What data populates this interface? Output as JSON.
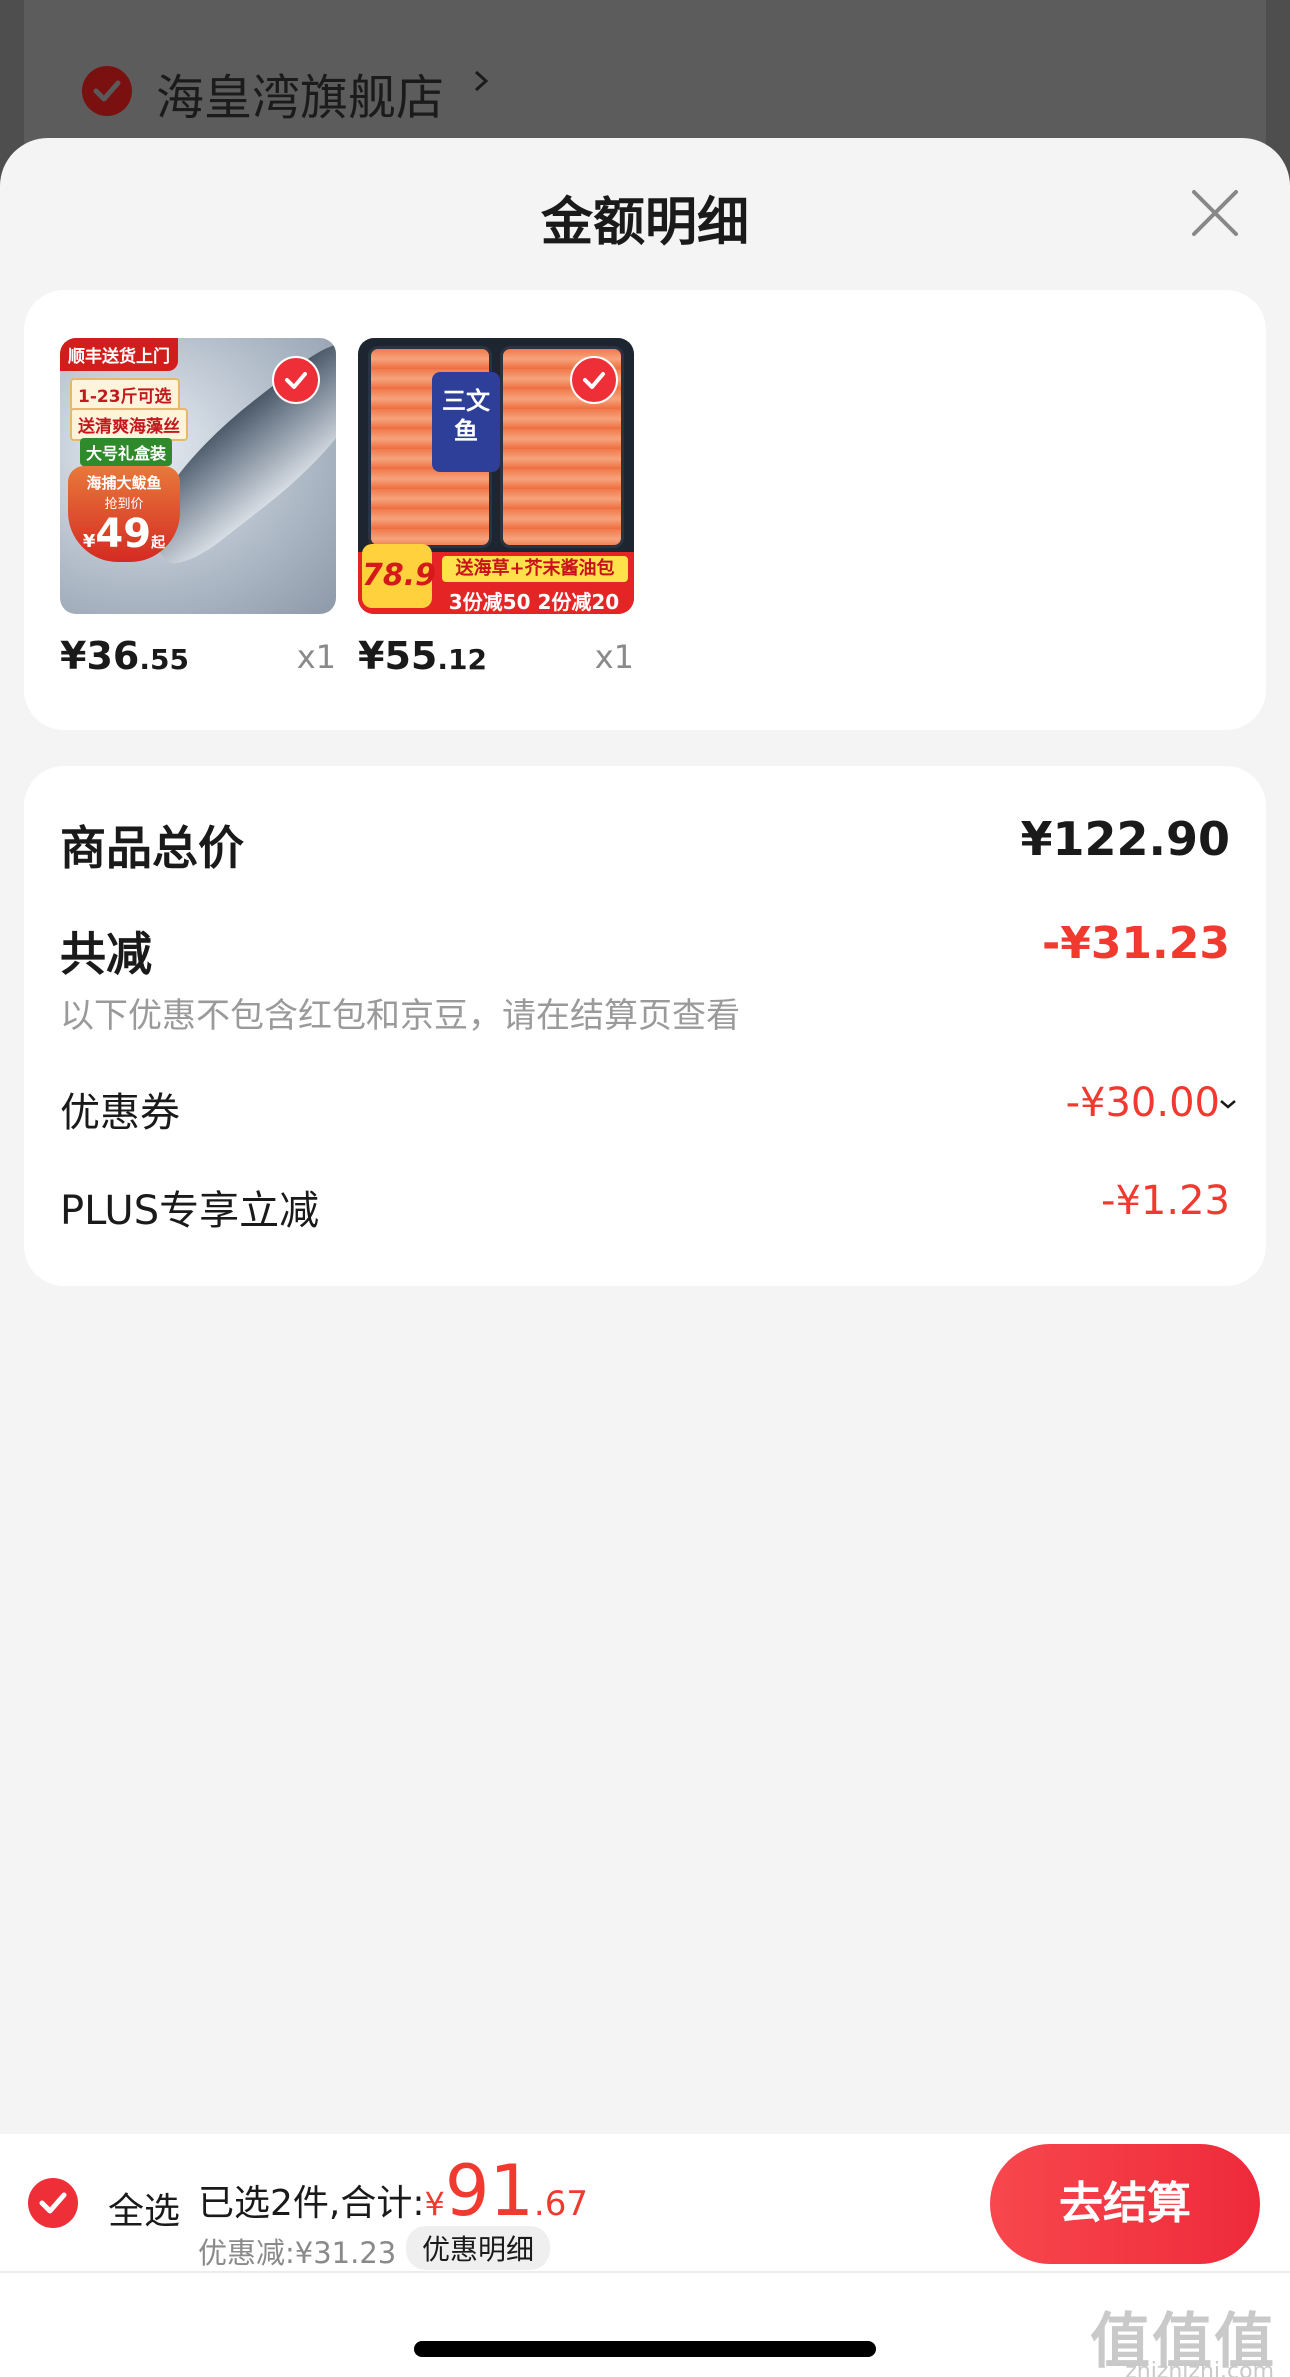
{
  "background": {
    "store_name": "海皇湾旗舰店"
  },
  "sheet": {
    "title": "金额明细"
  },
  "products": [
    {
      "price_int": "¥36",
      "price_dec": ".55",
      "qty": "x1",
      "image_texts": [
        "顺丰送货上门",
        "1-23斤可选",
        "送清爽海藻丝",
        "大号礼盒装",
        "海捕大鲅鱼",
        "抢到价",
        "¥",
        "49",
        "起"
      ],
      "selected": true
    },
    {
      "price_int": "¥55",
      "price_dec": ".12",
      "qty": "x1",
      "image_texts": [
        "三文鱼",
        "送海草+芥末酱油包",
        "3份减50 2份减20",
        "78.9"
      ],
      "selected": true
    }
  ],
  "summary": {
    "total_label": "商品总价",
    "total_value": "¥122.90",
    "reduce_label": "共减",
    "reduce_value": "-¥31.23",
    "note": "以下优惠不包含红包和京豆，请在结算页查看",
    "coupon_label": "优惠券",
    "coupon_value": "-¥30.00",
    "plus_label": "PLUS专享立减",
    "plus_value": "-¥1.23"
  },
  "bottom_bar": {
    "select_all": "全选",
    "selected_text": "已选2件,合计:",
    "currency": "¥",
    "total_int": "91",
    "total_dec": ".67",
    "discount_text": "优惠减:¥31.23",
    "detail_label": "优惠明细",
    "checkout_label": "去结算"
  },
  "watermark": {
    "text": "值值值",
    "sub": "zhizhizhi.com"
  },
  "colors": {
    "accent_red": "#f03a2f",
    "checkout_gradient_start": "#f8474d",
    "checkout_gradient_end": "#ee2a3a",
    "sheet_bg": "#f4f4f4"
  }
}
